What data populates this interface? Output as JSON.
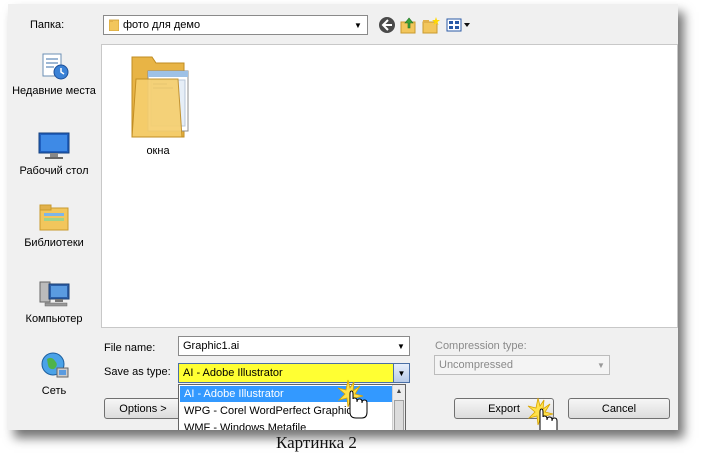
{
  "toolbar": {
    "folder_label": "Папка:",
    "folder_value": "фото для демо",
    "icons": [
      "back-icon",
      "up-folder-icon",
      "new-folder-icon",
      "view-menu-icon"
    ]
  },
  "places": [
    {
      "label": "Недавние места",
      "icon": "recent-places-icon"
    },
    {
      "label": "Рабочий стол",
      "icon": "desktop-icon"
    },
    {
      "label": "Библиотеки",
      "icon": "libraries-icon"
    },
    {
      "label": "Компьютер",
      "icon": "computer-icon"
    },
    {
      "label": "Сеть",
      "icon": "network-icon"
    }
  ],
  "files": [
    {
      "name": "окна",
      "icon": "folder-icon"
    }
  ],
  "form": {
    "file_name_label": "File name:",
    "file_name_value": "Graphic1.ai",
    "save_as_label": "Save as type:",
    "save_as_value": "AI - Adobe Illustrator",
    "compression_label": "Compression type:",
    "compression_value": "Uncompressed",
    "type_options": [
      "AI - Adobe Illustrator",
      "WPG - Corel WordPerfect Graphic",
      "WMF - Windows Metafile"
    ]
  },
  "buttons": {
    "options": "Options >",
    "export": "Export",
    "cancel": "Cancel"
  },
  "caption": "Картинка 2",
  "colors": {
    "highlight": "#ffff33",
    "selection": "#3399ff",
    "folder": "#f2c65c"
  }
}
